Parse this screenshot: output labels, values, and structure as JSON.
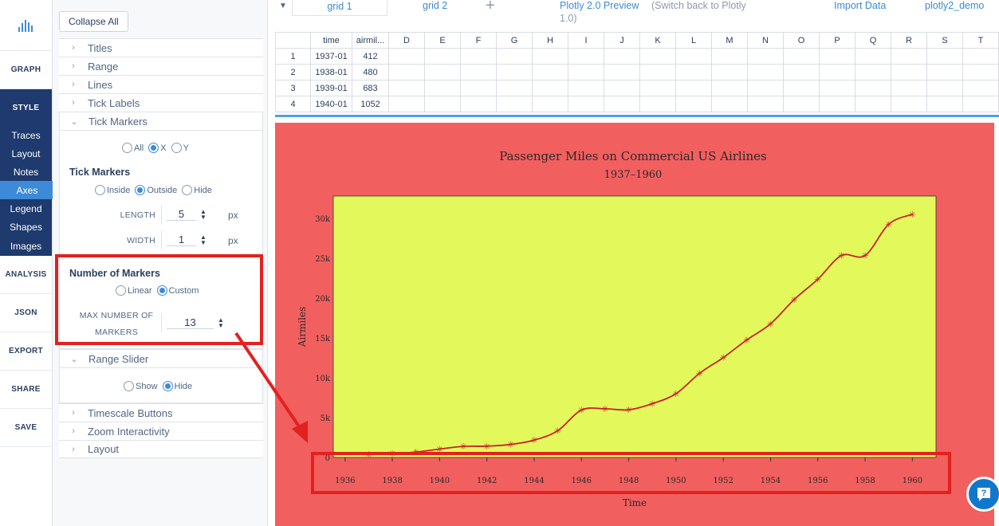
{
  "nav": {
    "items": [
      "GRAPH",
      "STYLE",
      "ANALYSIS",
      "JSON",
      "EXPORT",
      "SHARE",
      "SAVE"
    ],
    "style_sub": [
      "Traces",
      "Layout",
      "Notes",
      "Axes",
      "Legend",
      "Shapes",
      "Images"
    ],
    "active_sub": "Axes"
  },
  "panel": {
    "collapse_label": "Collapse All",
    "sections_top": [
      "Titles",
      "Range",
      "Lines",
      "Tick Labels"
    ],
    "tick_markers": {
      "header": "Tick Markers",
      "axis_options": [
        "All",
        "X",
        "Y"
      ],
      "axis_selected": "X",
      "label": "Tick Markers",
      "position_options": [
        "Inside",
        "Outside",
        "Hide"
      ],
      "position_selected": "Outside",
      "length_label": "LENGTH",
      "length_value": "5",
      "width_label": "WIDTH",
      "width_value": "1",
      "unit": "px"
    },
    "number_of_markers": {
      "label": "Number of Markers",
      "options": [
        "Linear",
        "Custom"
      ],
      "selected": "Custom",
      "max_label_1": "MAX NUMBER OF",
      "max_label_2": "MARKERS",
      "max_value": "13"
    },
    "range_slider": {
      "header": "Range Slider",
      "options": [
        "Show",
        "Hide"
      ],
      "selected": "Hide"
    },
    "sections_bottom": [
      "Timescale Buttons",
      "Zoom Interactivity",
      "Layout"
    ]
  },
  "topbar": {
    "grid1": "grid 1",
    "grid2": "grid 2",
    "plus": "+",
    "preview": "Plotly 2.0 Preview",
    "preview_ver": "1.0)",
    "switch_back": "(Switch back to Plotly",
    "import": "Import Data",
    "user": "plotly2_demo"
  },
  "grid": {
    "columns": [
      "time",
      "airmil...",
      "D",
      "E",
      "F",
      "G",
      "H",
      "I",
      "J",
      "K",
      "L",
      "M",
      "N",
      "O",
      "P",
      "Q",
      "R",
      "S",
      "T"
    ],
    "rows": [
      {
        "n": "1",
        "time": "1937-01",
        "airmiles": "412"
      },
      {
        "n": "2",
        "time": "1938-01",
        "airmiles": "480"
      },
      {
        "n": "3",
        "time": "1939-01",
        "airmiles": "683"
      },
      {
        "n": "4",
        "time": "1940-01",
        "airmiles": "1052"
      }
    ]
  },
  "colors": {
    "paper_bg": "#f25f5f",
    "plot_bg": "#e3f95b",
    "line": "#c8202a",
    "annotation": "#e3211f"
  },
  "chart_data": {
    "type": "line",
    "title": "Passenger Miles on Commercial US Airlines",
    "subtitle": "1937–1960",
    "xlabel": "Time",
    "ylabel": "Airmiles",
    "xlim": [
      1935.5,
      1961
    ],
    "ylim": [
      0,
      32800
    ],
    "xticks": [
      "1936",
      "1938",
      "1940",
      "1942",
      "1944",
      "1946",
      "1948",
      "1950",
      "1952",
      "1954",
      "1956",
      "1958",
      "1960"
    ],
    "yticks": [
      "0",
      "5k",
      "10k",
      "15k",
      "20k",
      "25k",
      "30k"
    ],
    "x": [
      1937,
      1938,
      1939,
      1940,
      1941,
      1942,
      1943,
      1944,
      1945,
      1946,
      1947,
      1948,
      1949,
      1950,
      1951,
      1952,
      1953,
      1954,
      1955,
      1956,
      1957,
      1958,
      1959,
      1960
    ],
    "y": [
      412,
      480,
      683,
      1052,
      1385,
      1418,
      1634,
      2178,
      3362,
      5948,
      6109,
      5981,
      6753,
      8003,
      10566,
      12528,
      14760,
      16769,
      19819,
      22362,
      25340,
      25343,
      29269,
      30514
    ],
    "grid": false,
    "legend": "none"
  }
}
